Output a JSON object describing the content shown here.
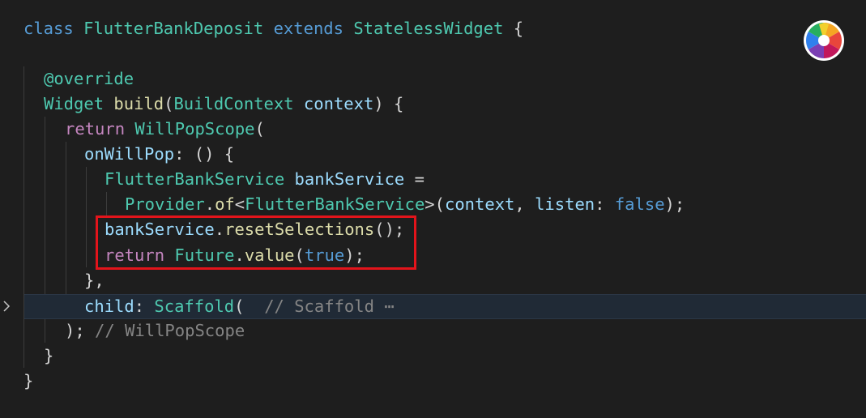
{
  "editor": {
    "lines": [
      {
        "tokens": [
          [
            "kw",
            "class"
          ],
          [
            "pun",
            " "
          ],
          [
            "cls",
            "FlutterBankDeposit"
          ],
          [
            "pun",
            " "
          ],
          [
            "kw",
            "extends"
          ],
          [
            "pun",
            " "
          ],
          [
            "cls",
            "StatelessWidget"
          ],
          [
            "pun",
            " {"
          ]
        ]
      },
      {
        "tokens": []
      },
      {
        "tokens": [
          [
            "ann",
            "@override"
          ]
        ]
      },
      {
        "tokens": [
          [
            "cls",
            "Widget"
          ],
          [
            "pun",
            " "
          ],
          [
            "fn",
            "build"
          ],
          [
            "pun",
            "("
          ],
          [
            "cls",
            "BuildContext"
          ],
          [
            "pun",
            " "
          ],
          [
            "var",
            "context"
          ],
          [
            "pun",
            ") {"
          ]
        ]
      },
      {
        "tokens": [
          [
            "ctl",
            "return"
          ],
          [
            "pun",
            " "
          ],
          [
            "cls",
            "WillPopScope"
          ],
          [
            "pun",
            "("
          ]
        ]
      },
      {
        "tokens": [
          [
            "var",
            "onWillPop"
          ],
          [
            "pun",
            ": () {"
          ]
        ]
      },
      {
        "tokens": [
          [
            "cls",
            "FlutterBankService"
          ],
          [
            "pun",
            " "
          ],
          [
            "var",
            "bankService"
          ],
          [
            "pun",
            " ="
          ]
        ]
      },
      {
        "tokens": [
          [
            "cls",
            "Provider"
          ],
          [
            "pun",
            "."
          ],
          [
            "fn",
            "of"
          ],
          [
            "pun",
            "<"
          ],
          [
            "cls",
            "FlutterBankService"
          ],
          [
            "pun",
            ">("
          ],
          [
            "var",
            "context"
          ],
          [
            "pun",
            ", "
          ],
          [
            "var",
            "listen"
          ],
          [
            "pun",
            ": "
          ],
          [
            "kw",
            "false"
          ],
          [
            "pun",
            ");"
          ]
        ]
      },
      {
        "tokens": [
          [
            "var",
            "bankService"
          ],
          [
            "pun",
            "."
          ],
          [
            "fn",
            "resetSelections"
          ],
          [
            "pun",
            "();"
          ]
        ]
      },
      {
        "tokens": [
          [
            "ctl",
            "return"
          ],
          [
            "pun",
            " "
          ],
          [
            "cls",
            "Future"
          ],
          [
            "pun",
            "."
          ],
          [
            "fn",
            "value"
          ],
          [
            "pun",
            "("
          ],
          [
            "kw",
            "true"
          ],
          [
            "pun",
            ");"
          ]
        ]
      },
      {
        "tokens": [
          [
            "pun",
            "},"
          ]
        ]
      },
      {
        "tokens": [
          [
            "var",
            "child"
          ],
          [
            "pun",
            ": "
          ],
          [
            "cls",
            "Scaffold"
          ],
          [
            "pun",
            "(  "
          ],
          [
            "cmt",
            "// Scaffold"
          ],
          [
            "cmt",
            " ⋯"
          ]
        ]
      },
      {
        "tokens": [
          [
            "pun",
            "); "
          ],
          [
            "cmt",
            "// WillPopScope"
          ]
        ]
      },
      {
        "tokens": [
          [
            "pun",
            "}"
          ]
        ]
      },
      {
        "tokens": [
          [
            "pun",
            "}"
          ]
        ]
      }
    ],
    "fold_icon": "chevron-right-icon",
    "highlight_color": "#e3141b",
    "badge_icon": "color-wheel-icon"
  }
}
